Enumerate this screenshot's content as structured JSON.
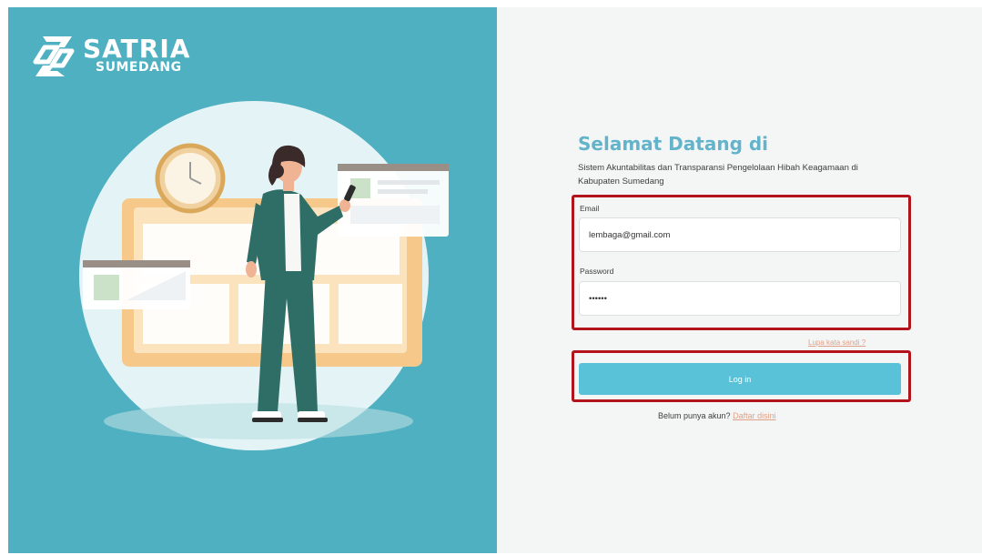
{
  "brand": {
    "name": "SATRIA",
    "subtitle": "SUMEDANG"
  },
  "welcome": {
    "title": "Selamat Datang di",
    "description": "Sistem Akuntabilitas dan Transparansi Pengelolaan Hibah Keagamaan di Kabupaten Sumedang"
  },
  "form": {
    "email_label": "Email",
    "email_value": "lembaga@gmail.com",
    "password_label": "Password",
    "password_value": "••••••",
    "forgot_label": "Lupa kata sandi ?",
    "login_label": "Log in",
    "register_prompt": "Belum punya akun?",
    "register_link": "Daftar disini"
  },
  "colors": {
    "left_panel": "#4eb0c1",
    "accent_title": "#63b4ca",
    "login_button": "#59c2d9",
    "highlight_box": "#b3141c",
    "link": "#e0a088"
  },
  "icons": {
    "brand_logo": "satria-logo-icon",
    "illustration": "woman-with-phone-illustration"
  }
}
